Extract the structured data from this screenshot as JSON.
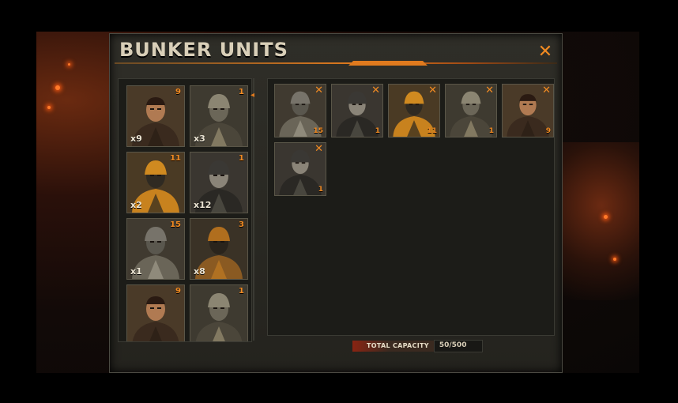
{
  "title": "BUNKER UNITS",
  "close_label": "✕",
  "colors": {
    "accent": "#f08a22",
    "panel": "#2b2a24",
    "cell": "#1c1c18"
  },
  "available_units": [
    {
      "level": "9",
      "count": "x9",
      "type": "officer",
      "icon": "officer-portrait-icon"
    },
    {
      "level": "1",
      "count": "x3",
      "type": "heavy-armor",
      "icon": "heavy-armor-portrait-icon"
    },
    {
      "level": "11",
      "count": "x2",
      "type": "mech-trooper",
      "icon": "mech-trooper-portrait-icon"
    },
    {
      "level": "1",
      "count": "x12",
      "type": "masked-soldier",
      "icon": "masked-soldier-portrait-icon"
    },
    {
      "level": "15",
      "count": "x1",
      "type": "gasmask-soldier",
      "icon": "gasmask-soldier-portrait-icon"
    },
    {
      "level": "3",
      "count": "x8",
      "type": "hazmat-trooper",
      "icon": "hazmat-trooper-portrait-icon"
    },
    {
      "level": "9",
      "count": "",
      "type": "officer",
      "icon": "officer-portrait-icon"
    },
    {
      "level": "1",
      "count": "",
      "type": "heavy-armor",
      "icon": "heavy-armor-portrait-icon"
    }
  ],
  "selected_units": [
    {
      "level": "15",
      "type": "gasmask-soldier",
      "icon": "gasmask-soldier-portrait-icon",
      "remove": "✕"
    },
    {
      "level": "1",
      "type": "masked-soldier",
      "icon": "masked-soldier-portrait-icon",
      "remove": "✕"
    },
    {
      "level": "11",
      "type": "mech-trooper",
      "icon": "mech-trooper-portrait-icon",
      "remove": "✕"
    },
    {
      "level": "1",
      "type": "heavy-armor",
      "icon": "heavy-armor-portrait-icon",
      "remove": "✕"
    },
    {
      "level": "9",
      "type": "officer",
      "icon": "officer-portrait-icon",
      "remove": "✕"
    },
    {
      "level": "1",
      "type": "masked-soldier",
      "icon": "masked-soldier-portrait-icon",
      "remove": "✕"
    }
  ],
  "capacity": {
    "label": "TOTAL CAPACITY",
    "value": "50/500"
  }
}
